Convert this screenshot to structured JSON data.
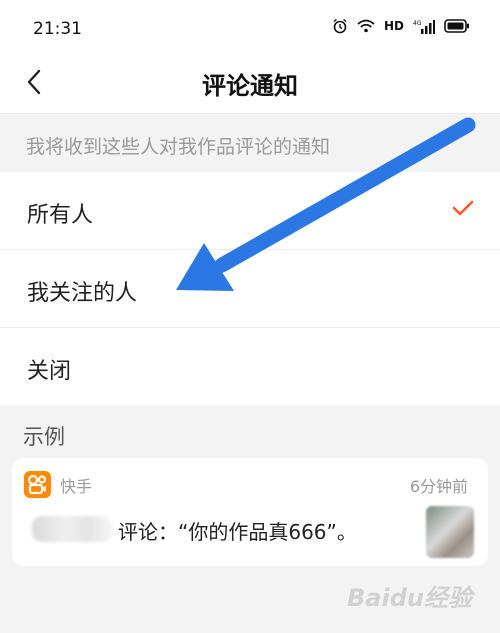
{
  "status_bar": {
    "time": "21:31",
    "network": "HD"
  },
  "nav": {
    "title": "评论通知"
  },
  "hint": "我将收到这些人对我作品评论的通知",
  "options": [
    {
      "label": "所有人",
      "selected": true
    },
    {
      "label": "我关注的人",
      "selected": false
    },
    {
      "label": "关闭",
      "selected": false
    }
  ],
  "example": {
    "header": "示例",
    "app_name": "快手",
    "time_ago": "6分钟前",
    "comment": "评论：“你的作品真666”。"
  },
  "watermark": "Baidu经验",
  "colors": {
    "accent": "#ff5a2a",
    "arrow": "#2b78e4",
    "app_icon": "#ff8a00"
  }
}
